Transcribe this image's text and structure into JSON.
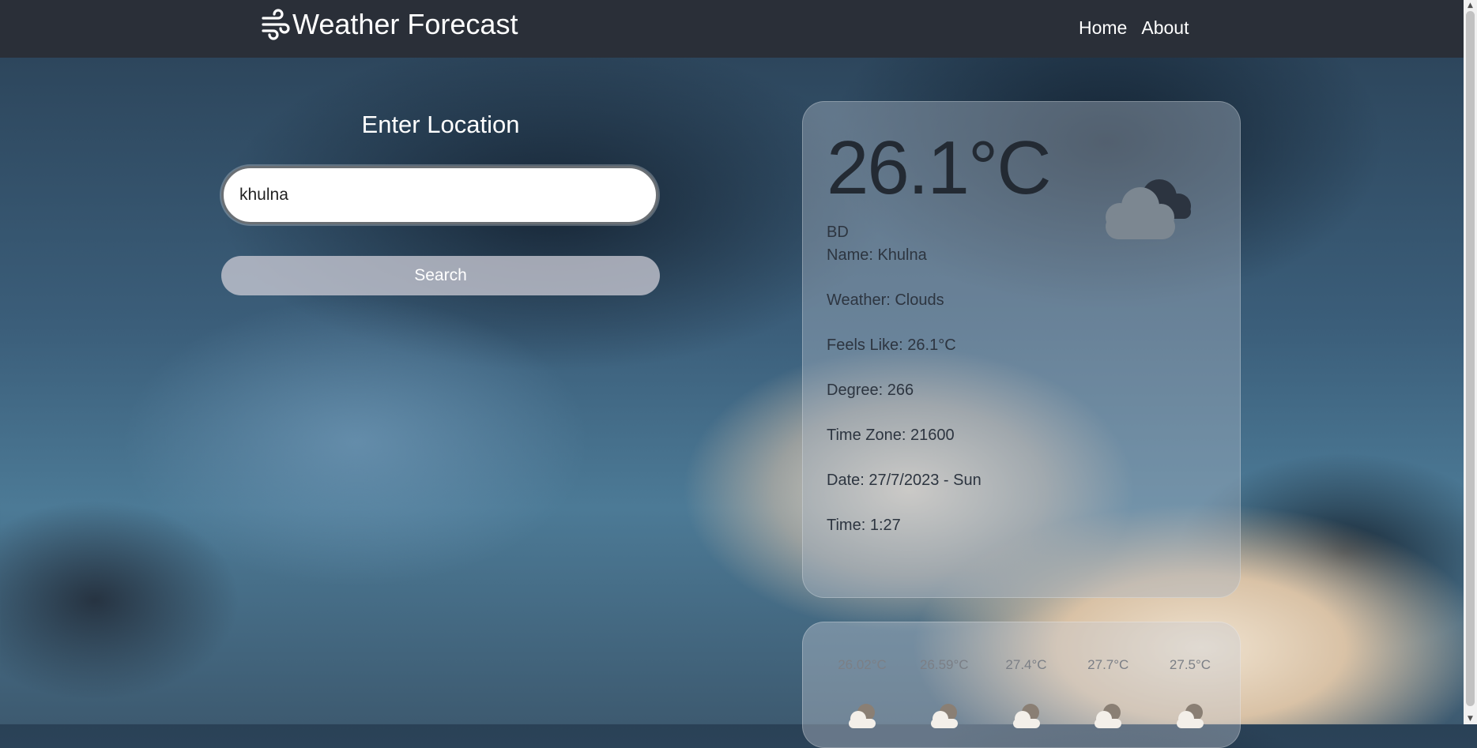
{
  "navbar": {
    "brand": "Weather Forecast",
    "brand_icon": "wind-icon",
    "links": [
      "Home",
      "About"
    ]
  },
  "search": {
    "title": "Enter Location",
    "input_value": "khulna",
    "button_label": "Search"
  },
  "weather": {
    "temperature": "26.1°C",
    "icon": "cloud-icon",
    "country": "BD",
    "name": "Name: Khulna",
    "condition": "Weather: Clouds",
    "feels_like": "Feels Like: 26.1°C",
    "degree": "Degree: 266",
    "time_zone": "Time Zone: 21600",
    "date": "Date: 27/7/2023 - Sun",
    "time": "Time: 1:27"
  },
  "forecast": {
    "items": [
      {
        "temp": "26.02°C",
        "icon": "partly-cloudy-icon"
      },
      {
        "temp": "26.59°C",
        "icon": "partly-cloudy-icon"
      },
      {
        "temp": "27.4°C",
        "icon": "partly-cloudy-icon"
      },
      {
        "temp": "27.7°C",
        "icon": "partly-cloudy-icon"
      },
      {
        "temp": "27.5°C",
        "icon": "partly-cloudy-icon"
      }
    ]
  },
  "colors": {
    "navbar": "#2a2f38",
    "card_text": "#2d3540",
    "button": "#c8c8d2"
  }
}
